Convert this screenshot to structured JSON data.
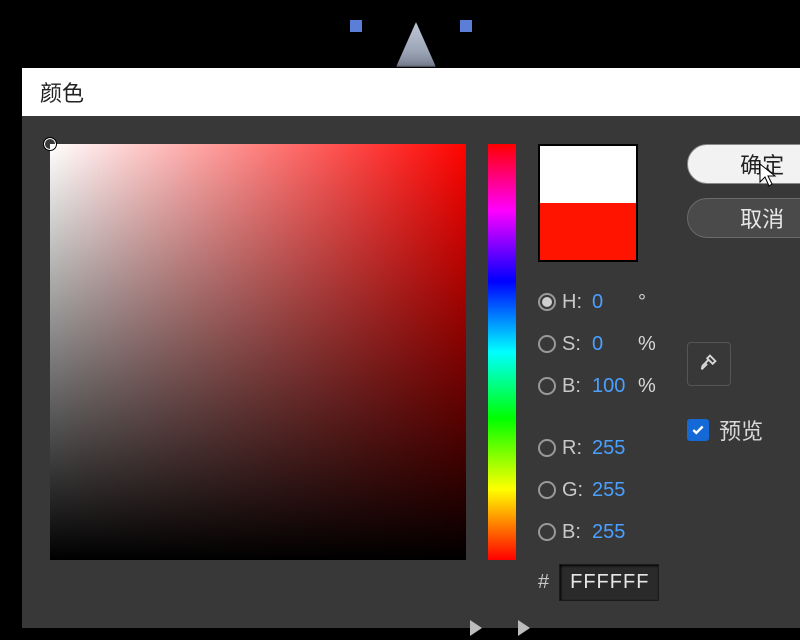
{
  "dialog": {
    "title": "颜色"
  },
  "swatch": {
    "new_color": "#FFFFFF",
    "old_color": "#FF1400"
  },
  "hsb": {
    "h_label": "H:",
    "h_value": "0",
    "h_unit": "°",
    "s_label": "S:",
    "s_value": "0",
    "s_unit": "%",
    "b_label": "B:",
    "b_value": "100",
    "b_unit": "%"
  },
  "rgb": {
    "r_label": "R:",
    "r_value": "255",
    "g_label": "G:",
    "g_value": "255",
    "b_label": "B:",
    "b_value": "255"
  },
  "hex": {
    "hash": "#",
    "value": "FFFFFF"
  },
  "buttons": {
    "ok": "确定",
    "cancel": "取消"
  },
  "preview": {
    "label": "预览",
    "checked": true
  }
}
